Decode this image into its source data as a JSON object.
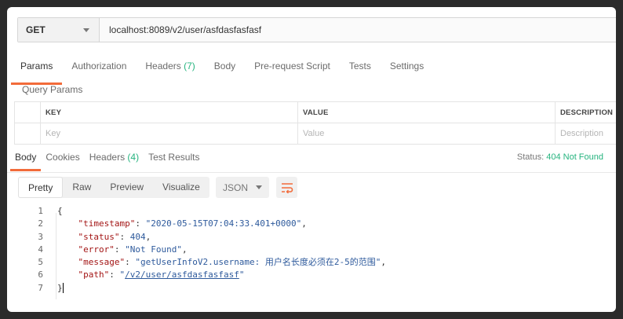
{
  "request": {
    "method": "GET",
    "url": "localhost:8089/v2/user/asfdasfasfasf"
  },
  "request_tabs": [
    {
      "label": "Params",
      "count": ""
    },
    {
      "label": "Authorization",
      "count": ""
    },
    {
      "label": "Headers",
      "count": "(7)"
    },
    {
      "label": "Body",
      "count": ""
    },
    {
      "label": "Pre-request Script",
      "count": ""
    },
    {
      "label": "Tests",
      "count": ""
    },
    {
      "label": "Settings",
      "count": ""
    }
  ],
  "query_params": {
    "title": "Query Params",
    "headers": {
      "key": "KEY",
      "value": "VALUE",
      "description": "DESCRIPTION"
    },
    "placeholders": {
      "key": "Key",
      "value": "Value",
      "description": "Description"
    }
  },
  "response_tabs": [
    {
      "label": "Body",
      "count": ""
    },
    {
      "label": "Cookies",
      "count": ""
    },
    {
      "label": "Headers",
      "count": "(4)"
    },
    {
      "label": "Test Results",
      "count": ""
    }
  ],
  "status": {
    "label": "Status:",
    "value": "404 Not Found"
  },
  "view_modes": [
    "Pretty",
    "Raw",
    "Preview",
    "Visualize"
  ],
  "format": "JSON",
  "body_lines": {
    "l1": "{",
    "timestamp_key": "\"timestamp\"",
    "timestamp_val": "\"2020-05-15T07:04:33.401+0000\"",
    "status_key": "\"status\"",
    "status_val": "404",
    "error_key": "\"error\"",
    "error_val": "\"Not Found\"",
    "message_key": "\"message\"",
    "message_val": "\"getUserInfoV2.username: 用户名长度必须在2-5的范围\"",
    "path_key": "\"path\"",
    "path_val": "/v2/user/asfdasfasfasf",
    "l7": "}"
  },
  "line_numbers": [
    "1",
    "2",
    "3",
    "4",
    "5",
    "6",
    "7"
  ],
  "colors": {
    "accent": "#f26b3a",
    "success": "#26b47f"
  }
}
